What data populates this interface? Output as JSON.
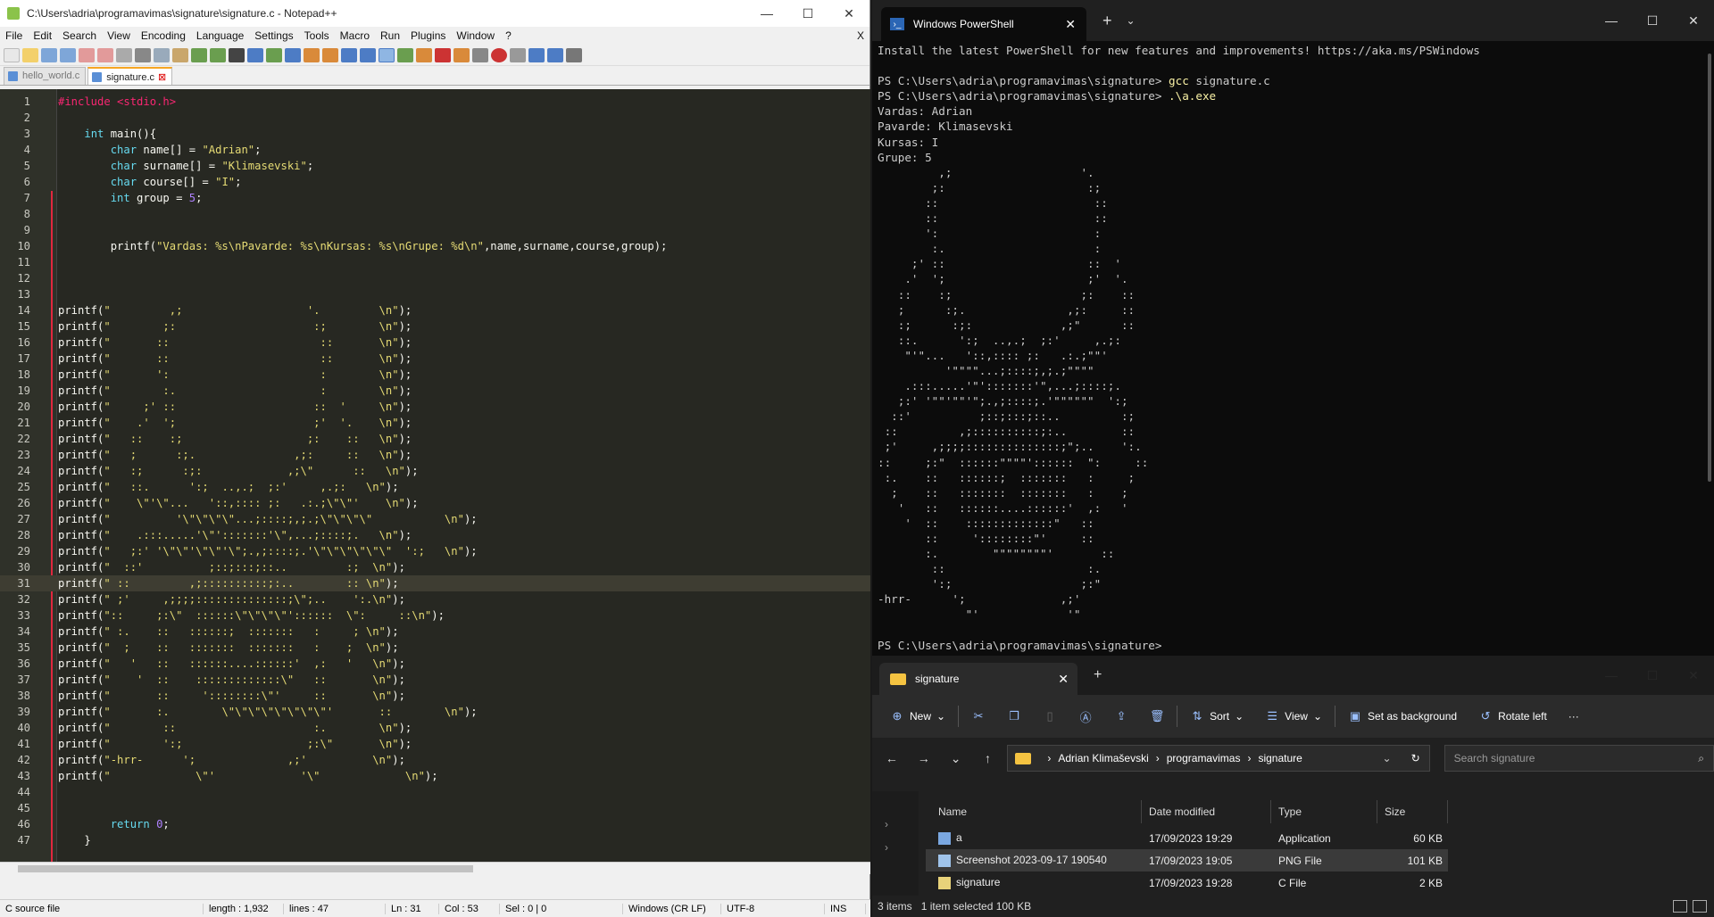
{
  "npp": {
    "title": "C:\\Users\\adria\\programavimas\\signature\\signature.c - Notepad++",
    "menu": [
      "File",
      "Edit",
      "Search",
      "View",
      "Encoding",
      "Language",
      "Settings",
      "Tools",
      "Macro",
      "Run",
      "Plugins",
      "Window",
      "?"
    ],
    "menu_close": "X",
    "tabs": [
      "hello_world.c",
      "signature.c"
    ],
    "lines": [
      "#include <stdio.h>",
      "",
      "    int main(){",
      "        char name[] = \"Adrian\";",
      "        char surname[] = \"Klimasevski\";",
      "        char course[] = \"I\";",
      "        int group = 5;",
      "",
      "",
      "        printf(\"Vardas: %s\\nPavarde: %s\\nKursas: %s\\nGrupe: %d\\n\",name,surname,course,group);",
      "",
      "",
      "",
      "printf(\"         ,;                   '.         \\n\");",
      "printf(\"        ;:                     :;        \\n\");",
      "printf(\"       ::                       ::       \\n\");",
      "printf(\"       ::                       ::       \\n\");",
      "printf(\"       ':                       :        \\n\");",
      "printf(\"        :.                      :        \\n\");",
      "printf(\"     ;' ::                     ::  '     \\n\");",
      "printf(\"    .'  ';                     ;'  '.    \\n\");",
      "printf(\"   ::    :;                   ;:    ::   \\n\");",
      "printf(\"   ;      :;.               ,;:     ::   \\n\");",
      "printf(\"   :;      :;:             ,;\\\"      ::   \\n\");",
      "printf(\"   ::.      ':;  ..,.;  ;:'     ,.;:   \\n\");",
      "printf(\"    \\\"'\\\"...   '::,:::: ;:   .:.;\\\"\\\"'    \\n\");",
      "printf(\"          '\\\"\\\"\\\"\\\"...;::::;,;.;\\\"\\\"\\\"\\\"           \\n\");",
      "printf(\"    .:::.....'\\\"':::::::'\\\",...;::::;.   \\n\");",
      "printf(\"   ;:' '\\\"\\\"'\\\"\\\"'\\\";.,;::::;.'\\\"\\\"\\\"\\\"\\\"\\\"  ':;   \\n\");",
      "printf(\"  ::'          ;::;:::;::..         :;  \\n\");",
      "printf(\" ::         ,;::::::::::;:..        :: \\n\");",
      "printf(\" ;'     ,;;;;::::::::::::::;\\\";..    ':.\\n\");",
      "printf(\"::     ;:\\\"  ::::::\\\"\\\"\\\"\\\"'::::::  \\\":     ::\\n\");",
      "printf(\" :.    ::   ::::::;  :::::::   :     ; \\n\");",
      "printf(\"  ;    ::   :::::::  :::::::   :    ;  \\n\");",
      "printf(\"   '   ::   ::::::....::::::'  ,:   '   \\n\");",
      "printf(\"    '  ::    :::::::::::::\\\"   ::       \\n\");",
      "printf(\"       ::     '::::::::\\\"'     ::       \\n\");",
      "printf(\"       :.        \\\"\\\"\\\"\\\"\\\"\\\"\\\"\\\"'       ::        \\n\");",
      "printf(\"        ::                     :.        \\n\");",
      "printf(\"        ':;                   ;:\\\"       \\n\");",
      "printf(\"-hrr-      ';              ,;'          \\n\");",
      "printf(\"             \\\"'             '\\\"             \\n\");",
      "",
      "",
      "        return 0;",
      "    }"
    ],
    "status": {
      "type": "C source file",
      "length": "length : 1,932",
      "lines": "lines : 47",
      "ln": "Ln : 31",
      "col": "Col : 53",
      "sel": "Sel : 0 | 0",
      "eol": "Windows (CR LF)",
      "enc": "UTF-8",
      "mode": "INS"
    }
  },
  "ps": {
    "tab_title": "Windows PowerShell",
    "output": [
      "Install the latest PowerShell for new features and improvements! https://aka.ms/PSWindows",
      "",
      "PS C:\\Users\\adria\\programavimas\\signature> gcc signature.c",
      "PS C:\\Users\\adria\\programavimas\\signature> .\\a.exe",
      "Vardas: Adrian",
      "Pavarde: Klimasevski",
      "Kursas: I",
      "Grupe: 5",
      "         ,;                   '.",
      "        ;:                     :;",
      "       ::                       ::",
      "       ::                       ::",
      "       ':                       :",
      "        :.                      :",
      "     ;' ::                     ::  '",
      "    .'  ';                     ;'  '.",
      "   ::    :;                   ;:    ::",
      "   ;      :;.               ,;:     ::",
      "   :;      :;:             ,;\"      ::",
      "   ::.      ':;  ..,.;  ;:'     ,.;:",
      "    \"'\"...   '::,:::: ;:   .:.;\"\"'",
      "          '\"\"\"\"...;::::;,;.;\"\"\"\"",
      "    .:::.....'\"':::::::'\",...;::::;.",
      "   ;:' '\"\"'\"\"'\";.,;::::;.'\"\"\"\"\"\"  ':;",
      "  ::'          ;::;:::;::..         :;",
      " ::         ,;::::::::::;:..        ::",
      " ;'     ,;;;;::::::::::::::;\";..    ':.",
      "::     ;:\"  ::::::\"\"\"\"'::::::  \":     ::",
      " :.    ::   ::::::;  :::::::   :     ;",
      "  ;    ::   :::::::  :::::::   :    ;",
      "   '   ::   ::::::....::::::'  ,:   '",
      "    '  ::    :::::::::::::\"   ::",
      "       ::     '::::::::\"'     ::",
      "       :.        \"\"\"\"\"\"\"\"'       ::",
      "        ::                     :.",
      "        ':;                   ;:\"",
      "-hrr-      ';              ,;'",
      "             \"'             '\"",
      "",
      "PS C:\\Users\\adria\\programavimas\\signature>"
    ]
  },
  "fe": {
    "tab_title": "signature",
    "toolbar": {
      "new": "New",
      "sort": "Sort",
      "view": "View",
      "bg": "Set as background",
      "rotate": "Rotate left"
    },
    "crumbs": [
      "Adrian Klimaševski",
      "programavimas",
      "signature"
    ],
    "search_placeholder": "Search signature",
    "headers": [
      "Name",
      "Date modified",
      "Type",
      "Size"
    ],
    "rows": [
      {
        "name": "a",
        "date": "17/09/2023 19:29",
        "type": "Application",
        "size": "60 KB"
      },
      {
        "name": "Screenshot 2023-09-17 190540",
        "date": "17/09/2023 19:05",
        "type": "PNG File",
        "size": "101 KB"
      },
      {
        "name": "signature",
        "date": "17/09/2023 19:28",
        "type": "C File",
        "size": "2 KB"
      }
    ],
    "status_items": "3 items",
    "status_sel": "1 item selected  100 KB"
  }
}
